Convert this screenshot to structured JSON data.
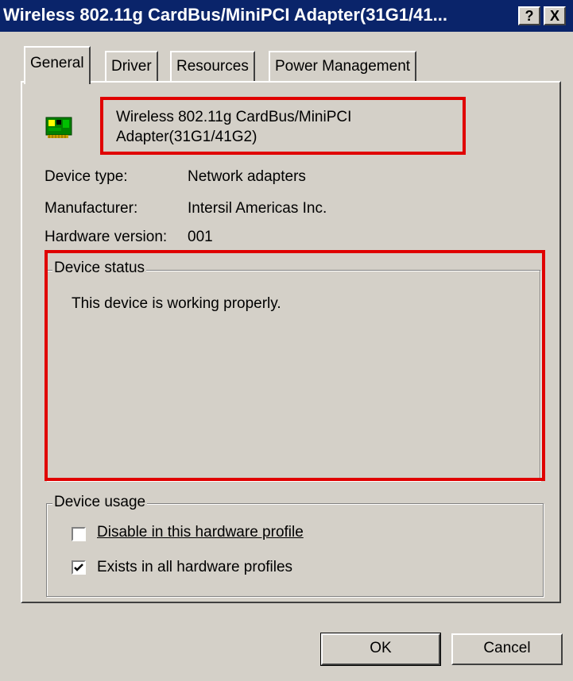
{
  "window": {
    "title": "Wireless 802.11g CardBus/MiniPCI Adapter(31G1/41...",
    "help_button": "?",
    "close_button": "X"
  },
  "tabs": [
    {
      "label": "General",
      "active": true
    },
    {
      "label": "Driver",
      "active": false
    },
    {
      "label": "Resources",
      "active": false
    },
    {
      "label": "Power Management",
      "active": false
    }
  ],
  "device": {
    "icon": "network-card-icon",
    "name_line1": "Wireless 802.11g CardBus/MiniPCI",
    "name_line2": "Adapter(31G1/41G2)"
  },
  "properties": {
    "device_type_label": "Device type:",
    "device_type_value": "Network adapters",
    "manufacturer_label": "Manufacturer:",
    "manufacturer_value": "Intersil Americas Inc.",
    "hardware_version_label": "Hardware version:",
    "hardware_version_value": "001"
  },
  "device_status": {
    "label": "Device status",
    "text": "This device is working properly."
  },
  "device_usage": {
    "label": "Device usage",
    "options": [
      {
        "label": "Disable in this hardware profile",
        "checked": false
      },
      {
        "label": "Exists in all hardware profiles",
        "checked": true
      }
    ]
  },
  "buttons": {
    "ok": "OK",
    "cancel": "Cancel"
  },
  "colors": {
    "titlebar": "#0a246a",
    "face": "#d4d0c8",
    "highlight_box": "#e00000"
  }
}
